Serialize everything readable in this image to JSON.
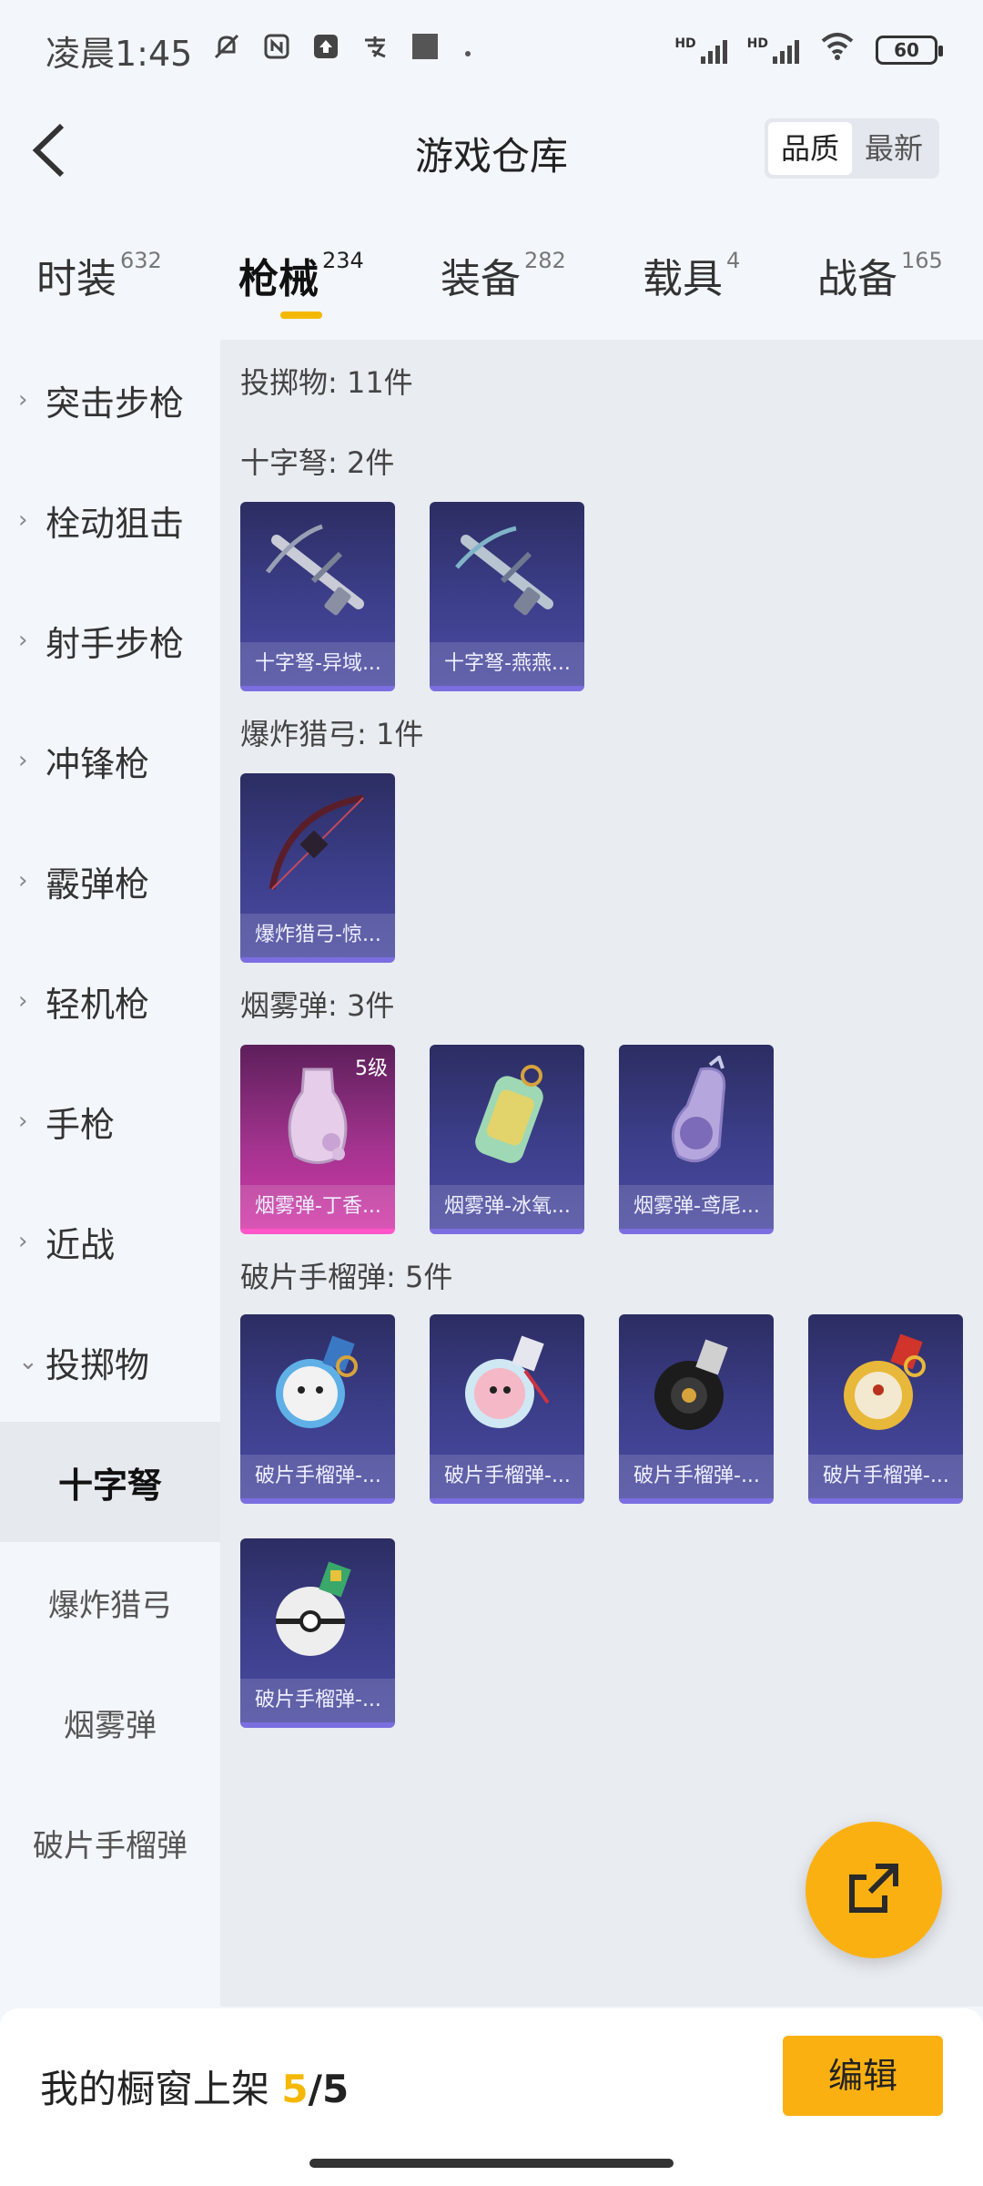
{
  "status": {
    "time": "凌晨1:45",
    "icons_left": [
      "dnd-bell-off-icon",
      "nfc-icon",
      "upload-icon",
      "alipay-icon",
      "square-icon",
      "dot-icon"
    ],
    "hd1": "HD",
    "hd2": "HD",
    "battery": "60"
  },
  "header": {
    "back_icon": "back-arrow-icon",
    "title": "游戏仓库",
    "sort": {
      "quality": "品质",
      "newest": "最新",
      "selected": "品质"
    }
  },
  "tabs": [
    {
      "label": "时装",
      "count": "632"
    },
    {
      "label": "枪械",
      "count": "234",
      "active": true
    },
    {
      "label": "装备",
      "count": "282"
    },
    {
      "label": "载具",
      "count": "4"
    },
    {
      "label": "战备",
      "count": "165"
    }
  ],
  "sidebar": {
    "items": [
      "突击步枪",
      "栓动狙击",
      "射手步枪",
      "冲锋枪",
      "霰弹枪",
      "轻机枪",
      "手枪",
      "近战",
      "投掷物"
    ],
    "subitems": [
      "十字弩",
      "爆炸猎弓",
      "烟雾弹",
      "破片手榴弹"
    ],
    "active_sub": "十字弩"
  },
  "main": {
    "summary": "投掷物: 11件",
    "sections": [
      {
        "title": "十字弩: 2件",
        "items": [
          {
            "label": "十字弩-异域..."
          },
          {
            "label": "十字弩-燕燕..."
          }
        ]
      },
      {
        "title": "爆炸猎弓: 1件",
        "items": [
          {
            "label": "爆炸猎弓-惊..."
          }
        ]
      },
      {
        "title": "烟雾弹: 3件",
        "items": [
          {
            "label": "烟雾弹-丁香...",
            "level": "5级"
          },
          {
            "label": "烟雾弹-冰氧..."
          },
          {
            "label": "烟雾弹-鸢尾..."
          }
        ]
      },
      {
        "title": "破片手榴弹: 5件",
        "items": [
          {
            "label": "破片手榴弹-..."
          },
          {
            "label": "破片手榴弹-..."
          },
          {
            "label": "破片手榴弹-..."
          },
          {
            "label": "破片手榴弹-..."
          },
          {
            "label": "破片手榴弹-..."
          }
        ]
      }
    ]
  },
  "fab": {
    "icon": "share-external-icon"
  },
  "bottom": {
    "shelf_label": "我的橱窗上架",
    "shelf_current": "5",
    "shelf_sep": "/",
    "shelf_max": "5",
    "edit_label": "编辑"
  },
  "colors": {
    "accent": "#fbb012",
    "indicator": "#f5b800",
    "card_blue": "#3d3f8c",
    "card_pink": "#d23aa8"
  }
}
